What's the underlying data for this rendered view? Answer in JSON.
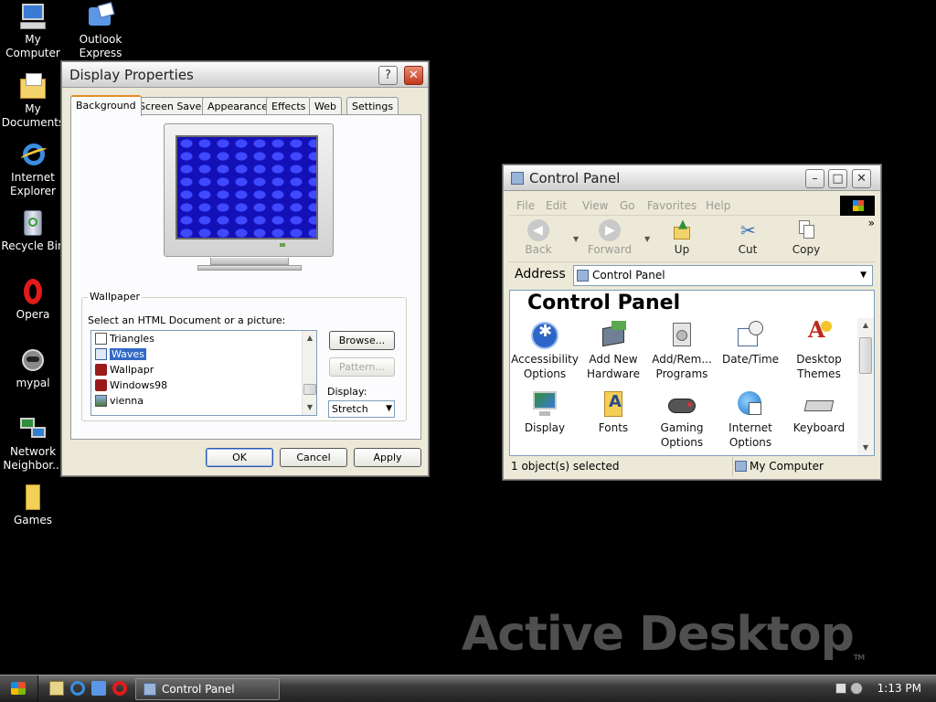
{
  "desktop": {
    "icons": [
      {
        "label": "My\nComputer",
        "icon": "my-computer-icon"
      },
      {
        "label": "Outlook\nExpress",
        "icon": "outlook-express-icon"
      },
      {
        "label": "My\nDocuments",
        "icon": "my-documents-icon"
      },
      {
        "label": "Internet\nExplorer",
        "icon": "internet-explorer-icon"
      },
      {
        "label": "Recycle Bin",
        "icon": "recycle-bin-icon"
      },
      {
        "label": "Opera",
        "icon": "opera-icon"
      },
      {
        "label": "mypal",
        "icon": "mypal-icon"
      },
      {
        "label": "Network\nNeighbor...",
        "icon": "network-neighborhood-icon"
      },
      {
        "label": "Games",
        "icon": "folder-icon"
      }
    ]
  },
  "display_properties": {
    "title": "Display Properties",
    "help_glyph": "?",
    "close_glyph": "✕",
    "tabs": [
      "Background",
      "Screen Saver",
      "Appearance",
      "Effects",
      "Web",
      "Settings"
    ],
    "active_tab": "Background",
    "wallpaper": {
      "legend": "Wallpaper",
      "prompt": "Select an HTML Document or a picture:",
      "items": [
        "Triangles",
        "Waves",
        "Wallpapr",
        "Windows98",
        "vienna"
      ],
      "selected": "Waves",
      "browse": "Browse...",
      "pattern": "Pattern...",
      "display_label": "Display:",
      "display_value": "Stretch"
    },
    "ok": "OK",
    "cancel": "Cancel",
    "apply": "Apply"
  },
  "control_panel": {
    "title": "Control Panel",
    "menu": [
      "File",
      "Edit",
      "View",
      "Go",
      "Favorites",
      "Help"
    ],
    "toolbar": {
      "back": "Back",
      "forward": "Forward",
      "up": "Up",
      "cut": "Cut",
      "copy": "Copy",
      "more": "»"
    },
    "address_label": "Address",
    "address_value": "Control Panel",
    "heading": "Control Panel",
    "items": [
      {
        "label": "Accessibility\nOptions",
        "icon": "accessibility-icon"
      },
      {
        "label": "Add New\nHardware",
        "icon": "add-hardware-icon"
      },
      {
        "label": "Add/Rem...\nPrograms",
        "icon": "add-remove-programs-icon"
      },
      {
        "label": "Date/Time",
        "icon": "date-time-icon"
      },
      {
        "label": "Desktop\nThemes",
        "icon": "desktop-themes-icon"
      },
      {
        "label": "Display",
        "icon": "display-icon"
      },
      {
        "label": "Fonts",
        "icon": "fonts-icon"
      },
      {
        "label": "Gaming\nOptions",
        "icon": "gaming-icon"
      },
      {
        "label": "Internet\nOptions",
        "icon": "internet-options-icon"
      },
      {
        "label": "Keyboard",
        "icon": "keyboard-icon"
      }
    ],
    "status_left": "1 object(s) selected",
    "status_right": "My Computer"
  },
  "watermark": {
    "text": "Active Desktop",
    "tm": "TM"
  },
  "taskbar": {
    "task_label": "Control Panel",
    "clock": "1:13 PM"
  }
}
